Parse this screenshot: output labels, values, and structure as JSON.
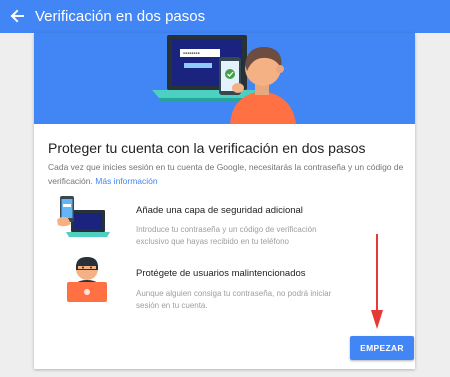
{
  "appbar": {
    "title": "Verificación en dos pasos",
    "back_icon": "arrow-back-icon",
    "color": "#4285f4"
  },
  "main": {
    "title": "Proteger tu cuenta con la verificación en dos pasos",
    "description": "Cada vez que inicies sesión en tu cuenta de Google, necesitarás la contraseña y un código de verificación.",
    "link_label": "Más información",
    "features": [
      {
        "icon": "phone-laptop-icon",
        "title": "Añade una capa de seguridad adicional",
        "text": "Introduce tu contraseña y un código de verificación exclusivo que hayas recibido en tu teléfono"
      },
      {
        "icon": "hacker-icon",
        "title": "Protégete de usuarios malintencionados",
        "text": "Aunque alguien consiga tu contraseña, no podrá iniciar sesión en tu cuenta."
      }
    ],
    "start_button": "EMPEZAR"
  },
  "colors": {
    "accent": "#4285f4",
    "annotation_arrow": "#e53935"
  }
}
